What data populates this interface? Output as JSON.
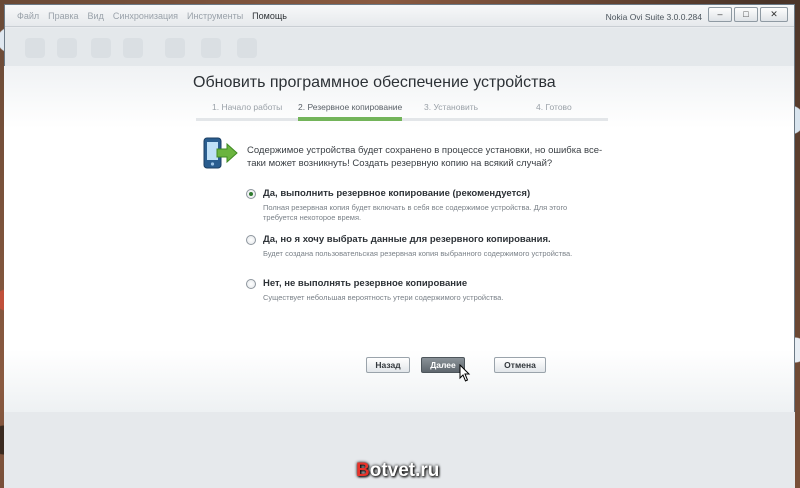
{
  "window": {
    "title": "Nokia Ovi Suite 3.0.0.284",
    "menu": [
      "Файл",
      "Правка",
      "Вид",
      "Синхронизация",
      "Инструменты",
      "Помощь"
    ],
    "controls": {
      "minimize": "–",
      "maximize": "□",
      "close": "✕"
    }
  },
  "dialog": {
    "title": "Обновить программное обеспечение устройства",
    "steps": [
      {
        "label": "1. Начало работы"
      },
      {
        "label": "2. Резервное копирование"
      },
      {
        "label": "3. Установить"
      },
      {
        "label": "4. Готово"
      }
    ],
    "active_step": 2,
    "intro": "Содержимое устройства будет сохранено в процессе установки, но ошибка все-таки может возникнуть! Создать резервную копию на всякий случай?",
    "options": [
      {
        "label": "Да, выполнить резервное копирование (рекомендуется)",
        "description": "Полная резервная копия будет включать в себя все содержимое устройства. Для этого требуется некоторое время.",
        "checked": true
      },
      {
        "label": "Да, но я хочу выбрать данные для резервного копирования.",
        "description": "Будет создана пользовательская резервная копия выбранного содержимого устройства.",
        "checked": false
      },
      {
        "label": "Нет, не выполнять резервное копирование",
        "description": "Существует небольшая вероятность утери содержимого устройства.",
        "checked": false
      }
    ],
    "buttons": {
      "back": "Назад",
      "next": "Далее",
      "cancel": "Отмена"
    }
  },
  "watermark": {
    "first": "B",
    "rest": "otvet.ru"
  },
  "colors": {
    "accent_green": "#73b45a",
    "primary_button": "#5e666d"
  }
}
